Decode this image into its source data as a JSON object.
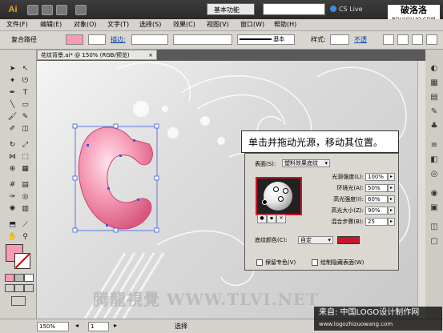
{
  "app": {
    "logo": "Ai",
    "workspace": "基本功能",
    "cs_live": "CS Live"
  },
  "watermark_logo": {
    "line1": "破洛洛",
    "line2": "POLUOLUO.COM"
  },
  "menu": [
    "文件(F)",
    "编辑(E)",
    "对象(O)",
    "文字(T)",
    "选择(S)",
    "效果(C)",
    "视图(V)",
    "窗口(W)",
    "帮助(H)"
  ],
  "control_bar": {
    "label": "复合路径",
    "stroke_label": "描边:",
    "style_value": "基本",
    "style_label": "样式:",
    "extra": "不透"
  },
  "doc_tab": {
    "title": "花纹背景.ai* @ 150% (RGB/预览)",
    "close": "×"
  },
  "canvas": {
    "watermark": "腾龍視覺 WWW.TLVI.NET"
  },
  "callout": {
    "text": "单击并拖动光源，移动其位置。"
  },
  "dialog": {
    "surface_label": "表面(S):",
    "surface_value": "塑料效果底纹",
    "rows": [
      {
        "label": "光源强度(L):",
        "value": "100%"
      },
      {
        "label": "环境光(A):",
        "value": "50%"
      },
      {
        "label": "高光强度(I):",
        "value": "60%"
      },
      {
        "label": "高光大小(Z):",
        "value": "90%"
      },
      {
        "label": "混合步骤(B):",
        "value": "25"
      }
    ],
    "shading_label": "底纹颜色(C):",
    "shading_value": "自定",
    "shading_color": "#c4172e",
    "preserve_label": "保留专色(V)",
    "hidden_label": "绘制隐藏表面(W)"
  },
  "status": {
    "zoom": "150%",
    "page": "1",
    "text": "选择"
  },
  "source_watermark": {
    "line1": "来自: 中国LOGO设计制作网",
    "line2": "www.logozhizuowang.com"
  },
  "colors": {
    "fill": "#f59bb5",
    "accent": "#d0142c"
  }
}
